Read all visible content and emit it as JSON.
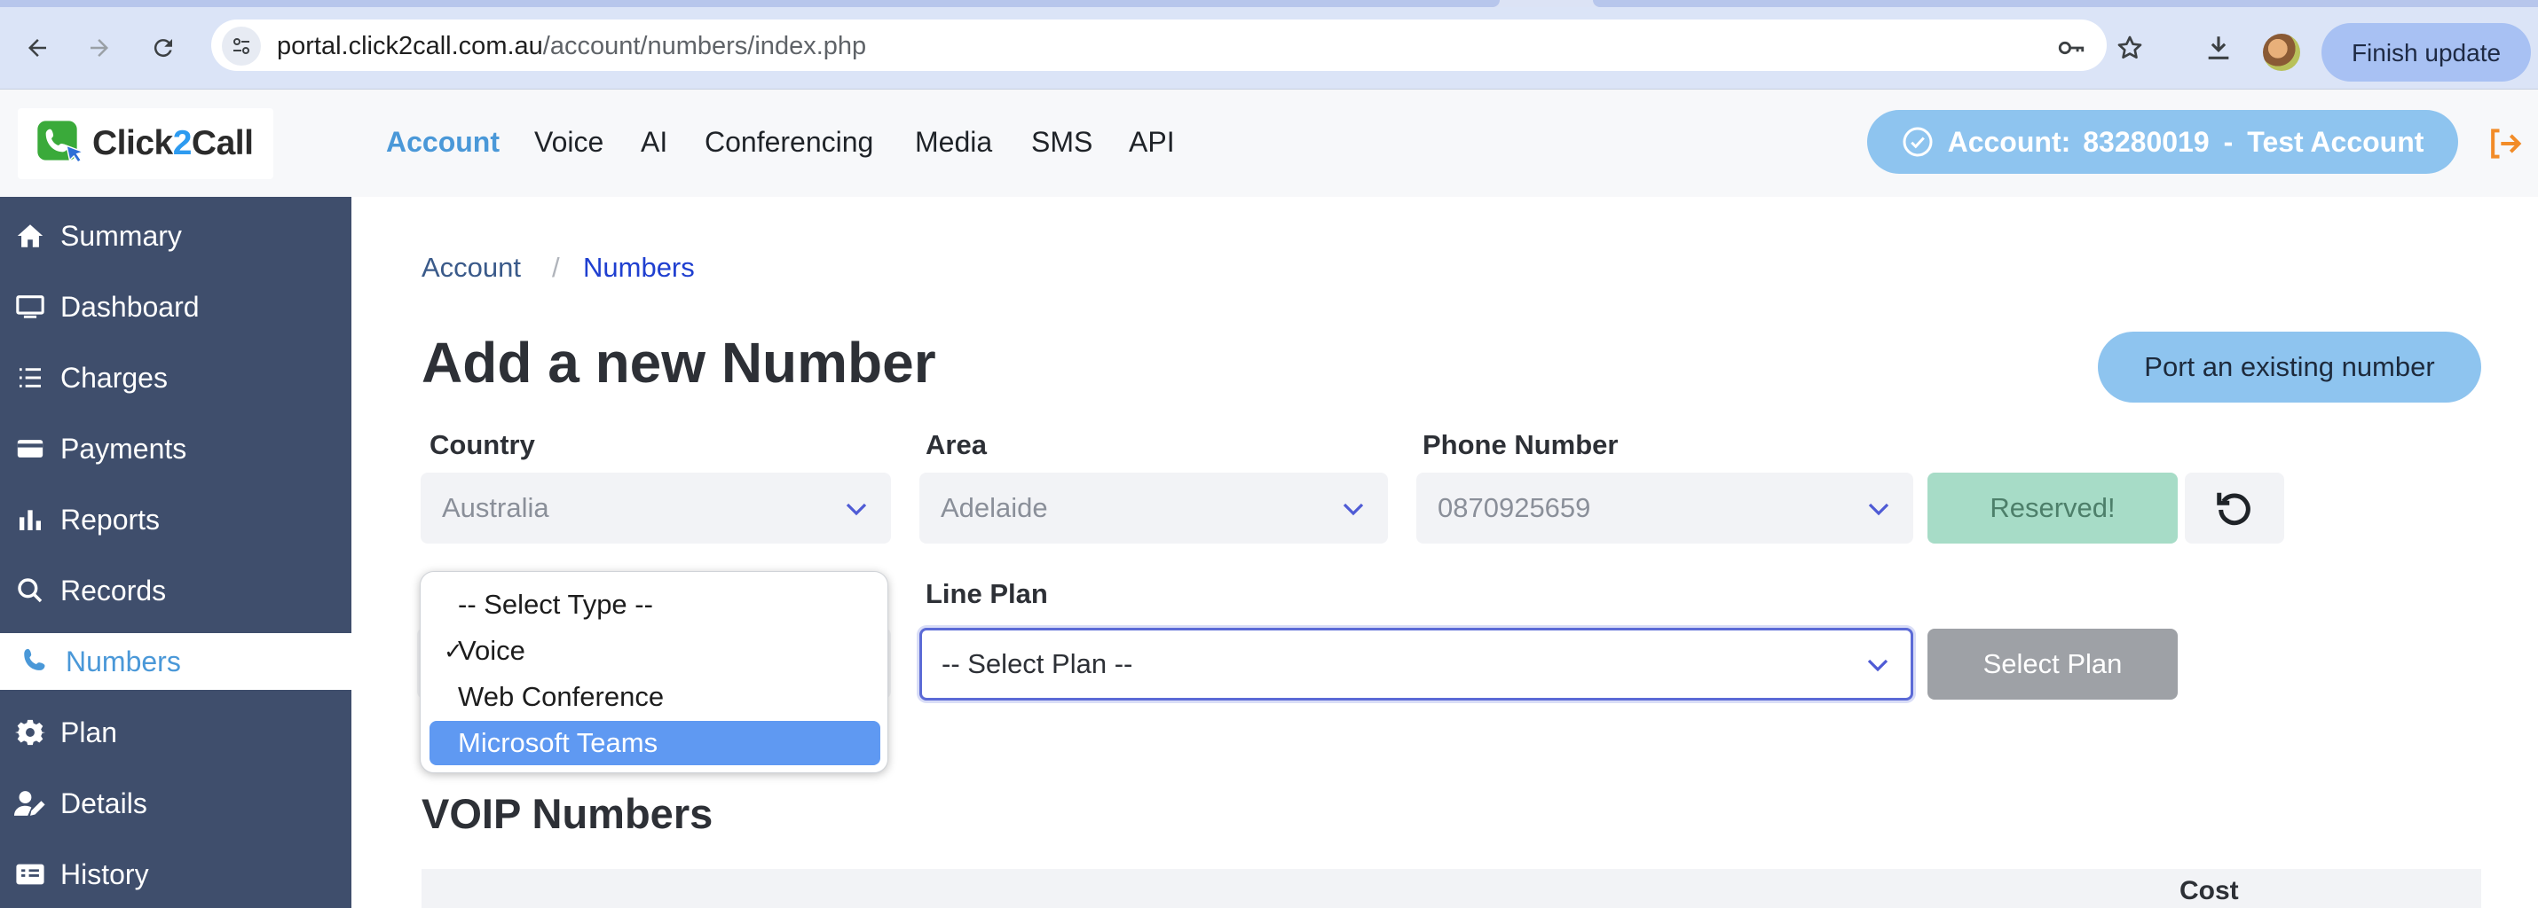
{
  "browser": {
    "url_host": "portal.click2call.com.au",
    "url_path": "/account/numbers/index.php",
    "finish_update": "Finish update",
    "icons": [
      "back-icon",
      "forward-icon",
      "reload-icon",
      "site-settings-icon",
      "key-icon",
      "star-icon",
      "download-icon"
    ]
  },
  "header": {
    "logo_text_a": "Click",
    "logo_text_b": "2",
    "logo_text_c": "Call",
    "nav": [
      "Account",
      "Voice",
      "AI",
      "Conferencing",
      "Media",
      "SMS",
      "API"
    ],
    "active_nav": "Account",
    "account_label": "Account:",
    "account_number": "83280019",
    "account_sep": "-",
    "account_name": "Test Account"
  },
  "sidebar": {
    "items": [
      {
        "label": "Summary",
        "icon": "home-icon"
      },
      {
        "label": "Dashboard",
        "icon": "monitor-icon"
      },
      {
        "label": "Charges",
        "icon": "list-icon"
      },
      {
        "label": "Payments",
        "icon": "credit-card-icon"
      },
      {
        "label": "Reports",
        "icon": "bar-chart-icon"
      },
      {
        "label": "Records",
        "icon": "search-icon"
      },
      {
        "label": "Numbers",
        "icon": "phone-icon",
        "active": true
      },
      {
        "label": "Plan",
        "icon": "gear-icon"
      },
      {
        "label": "Details",
        "icon": "user-edit-icon"
      },
      {
        "label": "History",
        "icon": "receipt-icon"
      }
    ]
  },
  "breadcrumb": {
    "root": "Account",
    "separator": "/",
    "current": "Numbers"
  },
  "page": {
    "title": "Add a new Number",
    "port_button": "Port an existing number"
  },
  "form": {
    "country_label": "Country",
    "country_value": "Australia",
    "area_label": "Area",
    "area_value": "Adelaide",
    "phone_label": "Phone Number",
    "phone_value": "0870925659",
    "reserved_button": "Reserved!",
    "line_plan_label": "Line Plan",
    "line_plan_value": "-- Select Plan --",
    "select_plan_button": "Select Plan"
  },
  "type_dropdown": {
    "options": [
      {
        "label": "-- Select Type --",
        "checked": false,
        "highlighted": false
      },
      {
        "label": "Voice",
        "checked": true,
        "highlighted": false
      },
      {
        "label": "Web Conference",
        "checked": false,
        "highlighted": false
      },
      {
        "label": "Microsoft Teams",
        "checked": false,
        "highlighted": true
      }
    ],
    "check_mark": "✓"
  },
  "voip": {
    "title": "VOIP Numbers",
    "cost_header": "Cost"
  },
  "colors": {
    "accent": "#4a98d8",
    "sidebar": "#3f4e6c",
    "pill": "#8ec4ef",
    "reserved": "#a7dcc7",
    "dropdown_highlight": "#5f99f2"
  }
}
